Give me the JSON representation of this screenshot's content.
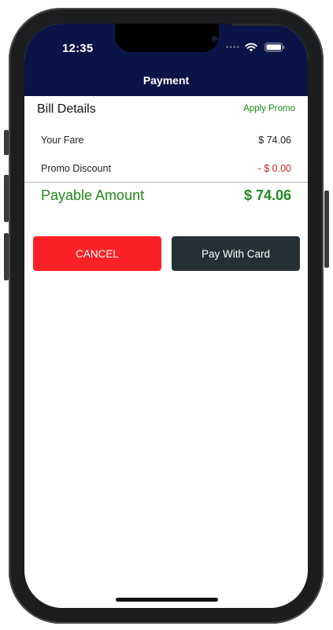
{
  "status_bar": {
    "time": "12:35"
  },
  "nav": {
    "title": "Payment"
  },
  "bill": {
    "title": "Bill Details",
    "apply_promo_label": "Apply Promo",
    "rows": [
      {
        "label": "Your Fare",
        "value": "$ 74.06"
      },
      {
        "label": "Promo Discount",
        "value": "- $ 0.00"
      }
    ],
    "payable": {
      "label": "Payable Amount",
      "value": "$ 74.06"
    }
  },
  "actions": {
    "cancel_label": "CANCEL",
    "card_label": "Pay With Card"
  },
  "colors": {
    "header_bg": "#0b1446",
    "accent_green": "#1f8a1f",
    "discount_red": "#c2261d",
    "cancel_red": "#fb2127",
    "card_dark": "#253035"
  },
  "icons": [
    "wifi-icon",
    "battery-icon",
    "camera-icon"
  ]
}
